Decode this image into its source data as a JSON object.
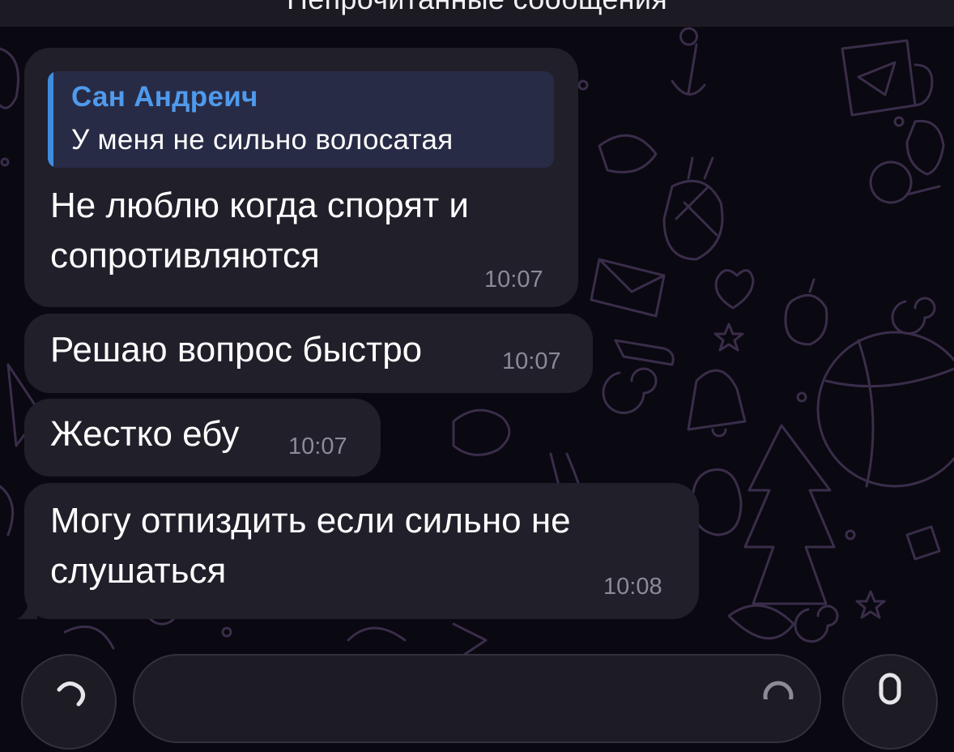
{
  "unread_banner": "Непрочитанные сообщения",
  "messages": [
    {
      "reply_to": {
        "author": "Сан Андреич",
        "text": "У меня не сильно волосатая"
      },
      "lines": [
        "Не люблю когда спорят и",
        "сопротивляются"
      ],
      "time": "10:07"
    },
    {
      "lines": [
        "Решаю вопрос быстро"
      ],
      "time": "10:07"
    },
    {
      "lines": [
        "Жестко ебу"
      ],
      "time": "10:07"
    },
    {
      "lines": [
        "Могу отпиздить если сильно не",
        "слушаться"
      ],
      "time": "10:08"
    }
  ],
  "colors": {
    "background": "#0a0810",
    "bubble": "#211f2a",
    "reply_accent": "#3e8ee0",
    "reply_author": "#4f9aec",
    "time": "#8d8a98",
    "doodle": "#3a2d4a"
  },
  "icons": {
    "attach": "paperclip-icon",
    "voice": "microphone-icon",
    "sticker": "sticker-icon"
  }
}
